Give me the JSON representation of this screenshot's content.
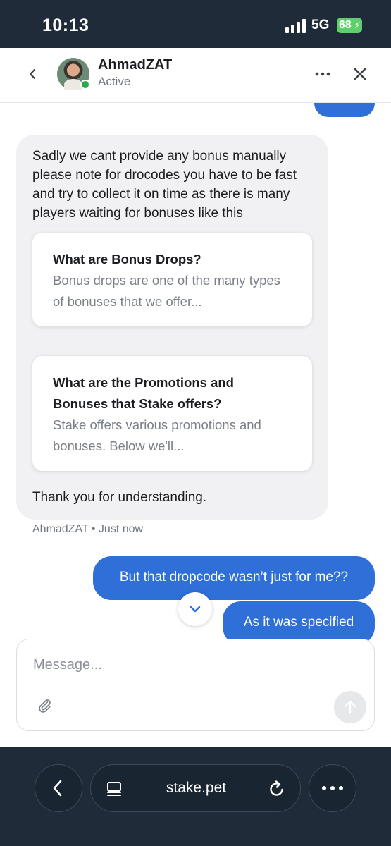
{
  "status_bar": {
    "time": "10:13",
    "network": "5G",
    "battery": "68"
  },
  "header": {
    "agent_name": "AhmadZAT",
    "agent_status": "Active"
  },
  "agent_message": {
    "text": "Sadly we cant provide any bonus manually please note for drocodes you have to be fast and try to collect it on time as there is many players waiting for bonuses like this",
    "cards": [
      {
        "title": "What are Bonus Drops?",
        "description": "Bonus drops are one of the many types of bonuses that we offer..."
      },
      {
        "title": "What are the Promotions and Bonuses that Stake offers?",
        "description": "Stake offers various promotions and bonuses. Below we'll..."
      }
    ],
    "closing": "Thank you for understanding.",
    "meta": "AhmadZAT • Just now"
  },
  "user_messages": [
    {
      "text": "But that dropcode wasn’t just for me??"
    },
    {
      "text": "As it was specified"
    }
  ],
  "composer": {
    "placeholder": "Message..."
  },
  "browser": {
    "url": "stake.pet"
  },
  "colors": {
    "accent": "#2f6fd8",
    "online": "#2ea84f",
    "browser_bg": "#1f2b38"
  }
}
